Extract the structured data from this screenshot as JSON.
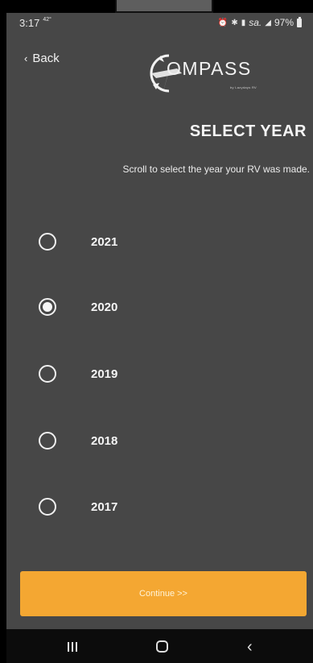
{
  "status_bar": {
    "time": "3:17",
    "temp": "42°",
    "icons_text": "sa.",
    "battery_percent": "97%"
  },
  "header": {
    "back_label": "Back",
    "logo_text": "OMPASS",
    "logo_subtext": "by Lazydays RV"
  },
  "page": {
    "title": "SELECT YEAR",
    "subtitle": "Scroll to select the year your RV was made."
  },
  "years": [
    {
      "label": "2021",
      "selected": false
    },
    {
      "label": "2020",
      "selected": true
    },
    {
      "label": "2019",
      "selected": false
    },
    {
      "label": "2018",
      "selected": false
    },
    {
      "label": "2017",
      "selected": false
    }
  ],
  "continue_label": "Continue >>",
  "colors": {
    "background": "#474747",
    "accent": "#f4a732"
  },
  "nav": {
    "icons": [
      "recents-icon",
      "home-icon",
      "back-icon"
    ]
  }
}
